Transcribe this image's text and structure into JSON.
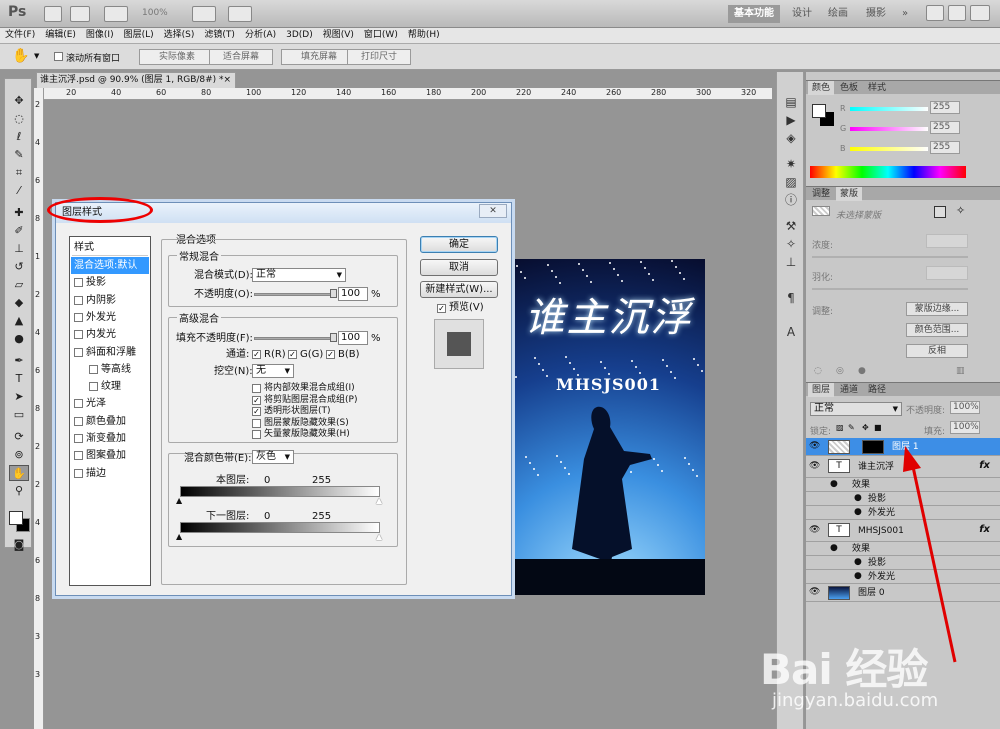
{
  "titlebar": {
    "app_logo": "Ps",
    "zoom": "100%",
    "workspaces": [
      "基本功能",
      "设计",
      "绘画",
      "摄影"
    ],
    "more": "»"
  },
  "menu": [
    "文件(F)",
    "编辑(E)",
    "图像(I)",
    "图层(L)",
    "选择(S)",
    "滤镜(T)",
    "分析(A)",
    "3D(D)",
    "视图(V)",
    "窗口(W)",
    "帮助(H)"
  ],
  "options": {
    "scroll_all_label": "滚动所有窗口",
    "buttons": [
      "实际像素",
      "适合屏幕",
      "填充屏幕",
      "打印尺寸"
    ]
  },
  "document": {
    "tab": "谁主沉浮.psd @ 90.9% (图层 1, RGB/8#) *",
    "close": "×",
    "ruler_h": [
      "20",
      "40",
      "60",
      "80",
      "100",
      "120",
      "140",
      "160",
      "180",
      "200",
      "220",
      "240",
      "260",
      "280",
      "300",
      "320"
    ],
    "ruler_v": [
      "2",
      "4",
      "6",
      "8",
      "1",
      "2",
      "4",
      "6",
      "8",
      "2",
      "2",
      "4",
      "6",
      "8",
      "3",
      "3"
    ]
  },
  "artwork": {
    "title": "谁主沉浮",
    "subtitle": "MHSJS001"
  },
  "dialog": {
    "title": "图层样式",
    "styles_header": "样式",
    "styles": [
      {
        "label": "混合选项:默认",
        "checkbox": false,
        "selected": true
      },
      {
        "label": "投影",
        "checkbox": true
      },
      {
        "label": "内阴影",
        "checkbox": true
      },
      {
        "label": "外发光",
        "checkbox": true
      },
      {
        "label": "内发光",
        "checkbox": true
      },
      {
        "label": "斜面和浮雕",
        "checkbox": true
      },
      {
        "label": "等高线",
        "checkbox": true,
        "indent": true
      },
      {
        "label": "纹理",
        "checkbox": true,
        "indent": true
      },
      {
        "label": "光泽",
        "checkbox": true
      },
      {
        "label": "颜色叠加",
        "checkbox": true
      },
      {
        "label": "渐变叠加",
        "checkbox": true
      },
      {
        "label": "图案叠加",
        "checkbox": true
      },
      {
        "label": "描边",
        "checkbox": true
      }
    ],
    "blend_options": "混合选项",
    "general": {
      "legend": "常规混合",
      "mode_label": "混合模式(D):",
      "mode_value": "正常",
      "opacity_label": "不透明度(O):",
      "opacity_value": "100",
      "unit": "%",
      "opacity_level": 1.0
    },
    "advanced": {
      "legend": "高级混合",
      "fill_label": "填充不透明度(F):",
      "fill_value": "100",
      "unit": "%",
      "fill_level": 1.0,
      "channels_label": "通道:",
      "channels": [
        "R(R)",
        "G(G)",
        "B(B)"
      ],
      "knockout_label": "挖空(N):",
      "knockout_value": "无",
      "options": [
        {
          "label": "将内部效果混合成组(I)",
          "checked": false
        },
        {
          "label": "将剪贴图层混合成组(P)",
          "checked": true
        },
        {
          "label": "透明形状图层(T)",
          "checked": true
        },
        {
          "label": "图层蒙版隐藏效果(S)",
          "checked": false
        },
        {
          "label": "矢量蒙版隐藏效果(H)",
          "checked": false
        }
      ]
    },
    "blendif": {
      "label": "混合颜色带(E):",
      "value": "灰色",
      "this_layer": "本图层:",
      "next_layer": "下一图层:",
      "lo": "0",
      "hi": "255",
      "lo2": "0",
      "hi2": "255"
    },
    "buttons": {
      "ok": "确定",
      "cancel": "取消",
      "new_style": "新建样式(W)...",
      "preview": "预览(V)"
    }
  },
  "panels": {
    "color_tabs": [
      "颜色",
      "色板",
      "样式"
    ],
    "color": {
      "r_label": "R",
      "g_label": "G",
      "b_label": "B",
      "r": "255",
      "g": "255",
      "b": "255"
    },
    "adjust_tabs": [
      "调整",
      "蒙版"
    ],
    "mask": {
      "status": "未选择蒙版",
      "density": "浓度:",
      "feather": "羽化:",
      "refine": "调整:",
      "edge_btn": "蒙版边缘...",
      "range_btn": "颜色范围...",
      "invert_btn": "反相"
    },
    "layers_tabs": [
      "图层",
      "通道",
      "路径"
    ],
    "layers": {
      "blend_mode": "正常",
      "opacity_label": "不透明度:",
      "opacity": "100%",
      "lock_label": "锁定:",
      "fill_label": "填充:",
      "fill": "100%",
      "items": [
        {
          "name": "图层 1",
          "type": "mask",
          "selected": true
        },
        {
          "name": "谁主沉浮",
          "type": "text",
          "fx": "fx",
          "effects_label": "效果",
          "effects": [
            "投影",
            "外发光"
          ]
        },
        {
          "name": "MHSJS001",
          "type": "text",
          "fx": "fx",
          "effects_label": "效果",
          "effects": [
            "投影",
            "外发光"
          ]
        },
        {
          "name": "图层 0",
          "type": "image"
        }
      ]
    }
  },
  "watermark": {
    "brand": "Bai  经验",
    "url": "jingyan.baidu.com"
  },
  "colors": {
    "dialog_select": "#3399ff",
    "layer_select": "#3d8ee6",
    "annotation": "#e00000"
  }
}
